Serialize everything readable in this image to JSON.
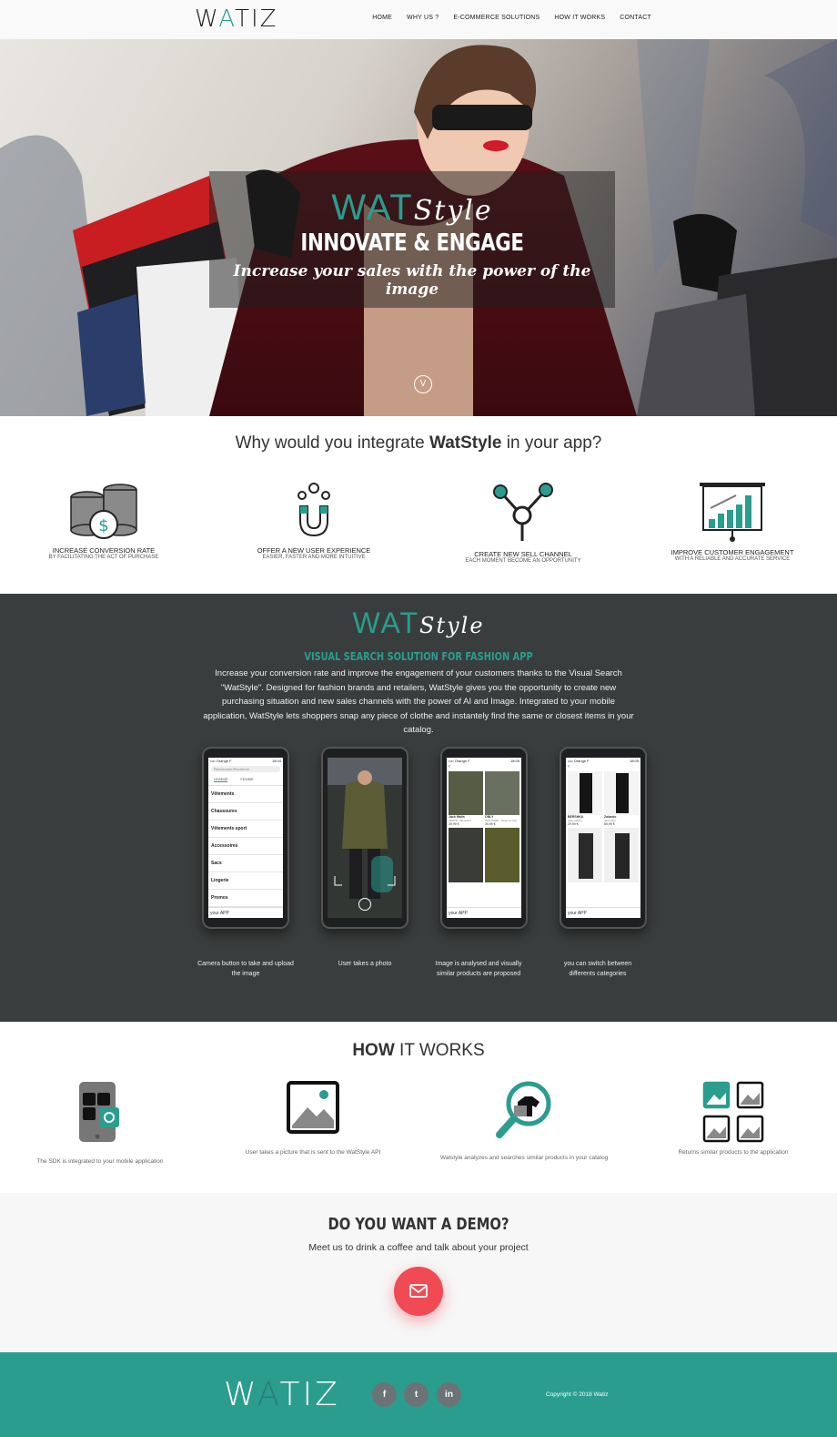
{
  "nav": {
    "logo_w": "W",
    "logo_a": "A",
    "logo_tiz": "TIZ",
    "links": [
      "HOME",
      "WHY US ?",
      "E-COMMERCE SOLUTIONS",
      "HOW IT WORKS",
      "CONTACT"
    ]
  },
  "hero": {
    "brand_wat": "WAT",
    "brand_style": "Style",
    "title": "INNOVATE & ENGAGE",
    "subtitle": "Increase your sales with the power of the image",
    "scroll_icon": "V"
  },
  "why": {
    "title_pre": "Why would you integrate ",
    "title_brand": "WatStyle",
    "title_post": " in your app?",
    "features": [
      {
        "icon": "coins-icon",
        "title": "INCREASE CONVERSION RATE",
        "subtitle": "BY FACILITATING THE ACT OF PURCHASE"
      },
      {
        "icon": "magnet-icon",
        "title": "OFFER A NEW USER EXPERIENCE",
        "subtitle": "EASIER, FASTER AND MORE INTUITIVE"
      },
      {
        "icon": "network-icon",
        "title": "CREATE NEW SELL CHANNEL",
        "subtitle": "EACH MOMENT BECOME AN OPPORTUNITY"
      },
      {
        "icon": "chart-board-icon",
        "title": "IMPROVE CUSTOMER ENGAGEMENT",
        "subtitle": "WITH A RELIABLE AND ACCURATE SERVICE"
      }
    ]
  },
  "solution": {
    "brand_wat": "WAT",
    "brand_style": "Style",
    "subtitle": "VISUAL SEARCH SOLUTION FOR FASHION APP",
    "text": "Increase your conversion rate and improve the engagement of your customers thanks to the Visual Search \"WatStyle\". Designed for fashion brands and retailers, WatStyle gives you the opportunity to create new purchasing situation and new sales channels with the power of AI and Image. Integrated to your mobile application, WatStyle lets shoppers snap any piece of clothe and instantely find the same or closest items in your catalog.",
    "phone1": {
      "carrier": "•••• Orange F",
      "time": "18:04",
      "search": "Rechercher/Recherch",
      "tabs": [
        "HOMME",
        "FEMME"
      ],
      "menu": [
        "Vêtements",
        "Chaussures",
        "Vêtements sport",
        "Accessoires",
        "Sacs",
        "Lingerie",
        "Promos"
      ],
      "bar_label": "your APP"
    },
    "phone3": {
      "carrier": "•••• Orange F",
      "time": "18:05",
      "items": [
        {
          "name": "Jack Walls",
          "desc": "VESTE - Blousons",
          "price": "39,99 €"
        },
        {
          "name": "ONLY",
          "desc": "ONLJODIE - Veste en cuir",
          "price": "39,99 €"
        }
      ],
      "bar_label": "your APP"
    },
    "phone4": {
      "carrier": "•••• Orange F",
      "time": "18:05",
      "items": [
        {
          "name": "BERSHKA",
          "desc": "Jean skinny",
          "price": "29,99 €"
        },
        {
          "name": "Zalando",
          "desc": "Jean slim",
          "price": "89,99 €"
        }
      ],
      "bar_label": "your APP"
    },
    "captions": [
      "Camera button to take and upload the image",
      "User takes a photo",
      "Image is analysed and visually similar products are proposed",
      "you can switch between differents categories"
    ]
  },
  "how": {
    "title_bold": "HOW",
    "title_rest": " IT WORKS",
    "steps": [
      {
        "icon": "phone-sdk-icon",
        "text": "The SDK is integrated to your mobile application"
      },
      {
        "icon": "picture-icon",
        "text": "User takes a picture that is sent to the WatStyle API"
      },
      {
        "icon": "magnifier-clothes-icon",
        "text": "Watstyle analyzes and searches similar products in your catalog"
      },
      {
        "icon": "picture-grid-icon",
        "text": "Returns similar products to the application"
      }
    ]
  },
  "demo": {
    "title": "DO YOU WANT A DEMO?",
    "subtitle": "Meet us to drink a coffee and talk about your project",
    "button_icon": "envelope-icon"
  },
  "footer": {
    "logo_w": "W",
    "logo_a": "A",
    "logo_tiz": "TIZ",
    "social": [
      "f",
      "t",
      "in"
    ],
    "copyright": "Copyright © 2018 Watiz"
  },
  "colors": {
    "accent": "#2a9d8f",
    "dark": "#3a3d3d",
    "demo_button": "#f04a55"
  }
}
